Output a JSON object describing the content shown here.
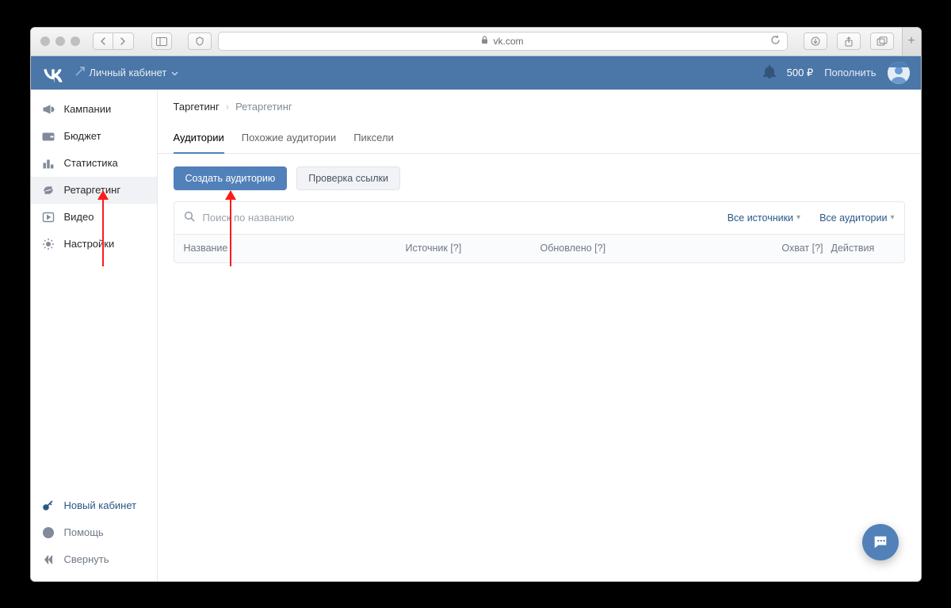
{
  "browser": {
    "url_host": "vk.com"
  },
  "header": {
    "cabinet_label": "Личный кабинет",
    "balance": "500 ₽",
    "topup_label": "Пополнить"
  },
  "sidebar": {
    "items": [
      {
        "id": "campaigns",
        "label": "Кампании"
      },
      {
        "id": "budget",
        "label": "Бюджет"
      },
      {
        "id": "stats",
        "label": "Статистика"
      },
      {
        "id": "retarget",
        "label": "Ретаргетинг"
      },
      {
        "id": "video",
        "label": "Видео"
      },
      {
        "id": "settings",
        "label": "Настройки"
      }
    ],
    "bottom": [
      {
        "id": "new_cab",
        "label": "Новый кабинет"
      },
      {
        "id": "help",
        "label": "Помощь"
      },
      {
        "id": "collapse",
        "label": "Свернуть"
      }
    ]
  },
  "breadcrumb": {
    "root": "Таргетинг",
    "current": "Ретаргетинг"
  },
  "tabs": [
    {
      "id": "audiences",
      "label": "Аудитории"
    },
    {
      "id": "lookalike",
      "label": "Похожие аудитории"
    },
    {
      "id": "pixels",
      "label": "Пиксели"
    }
  ],
  "actions": {
    "create_audience": "Создать аудиторию",
    "check_link": "Проверка ссылки"
  },
  "filters": {
    "search_placeholder": "Поиск по названию",
    "source_select": "Все источники",
    "audience_select": "Все аудитории"
  },
  "table": {
    "columns": {
      "name": "Название",
      "source": "Источник [?]",
      "updated": "Обновлено [?]",
      "reach": "Охват [?]",
      "actions": "Действия"
    }
  }
}
